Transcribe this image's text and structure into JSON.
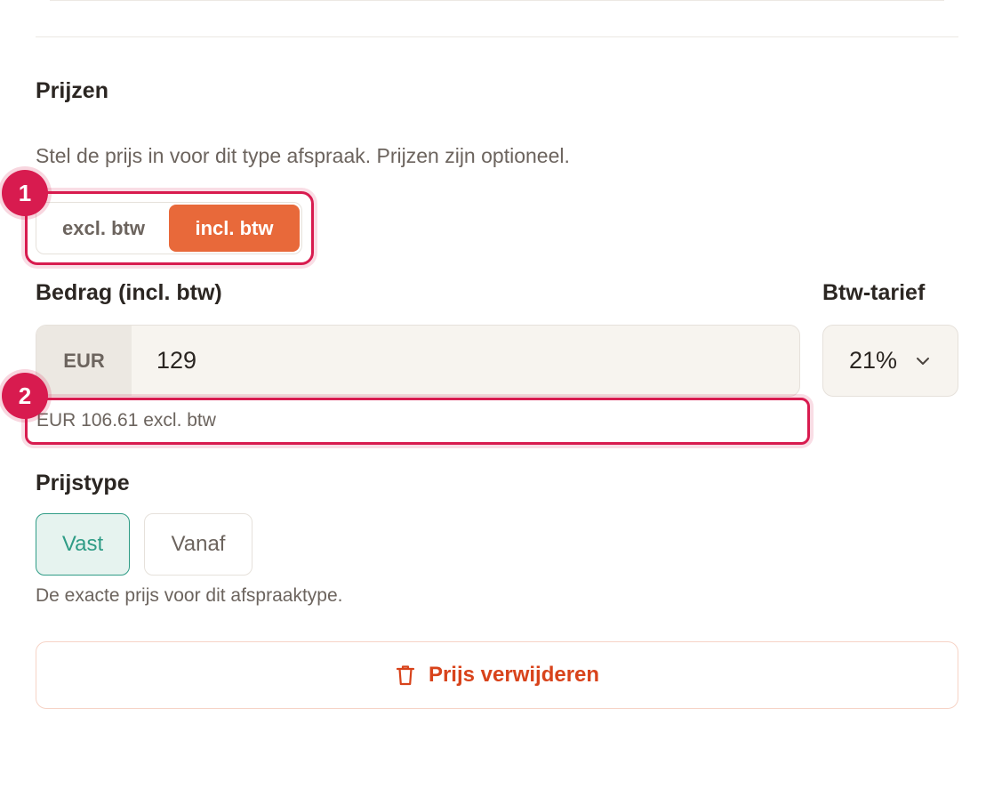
{
  "pricing": {
    "title": "Prijzen",
    "description": "Stel de prijs in voor dit type afspraak. Prijzen zijn optioneel.",
    "toggle": {
      "excl_label": "excl. btw",
      "incl_label": "incl. btw",
      "selected": "incl. btw"
    },
    "amount": {
      "label": "Bedrag (incl. btw)",
      "currency": "EUR",
      "value": "129"
    },
    "vat": {
      "label": "Btw-tarief",
      "value": "21%"
    },
    "excl_note": "EUR 106.61 excl. btw",
    "price_type": {
      "label": "Prijstype",
      "options": [
        "Vast",
        "Vanaf"
      ],
      "selected": "Vast",
      "help": "De exacte prijs voor dit afspraaktype."
    },
    "remove_label": "Prijs verwijderen"
  },
  "annotations": {
    "badge_1": "1",
    "badge_2": "2"
  },
  "colors": {
    "accent": "#e8693a",
    "highlight": "#d81b4f",
    "teal": "#2f9c86",
    "danger": "#d8431b"
  }
}
